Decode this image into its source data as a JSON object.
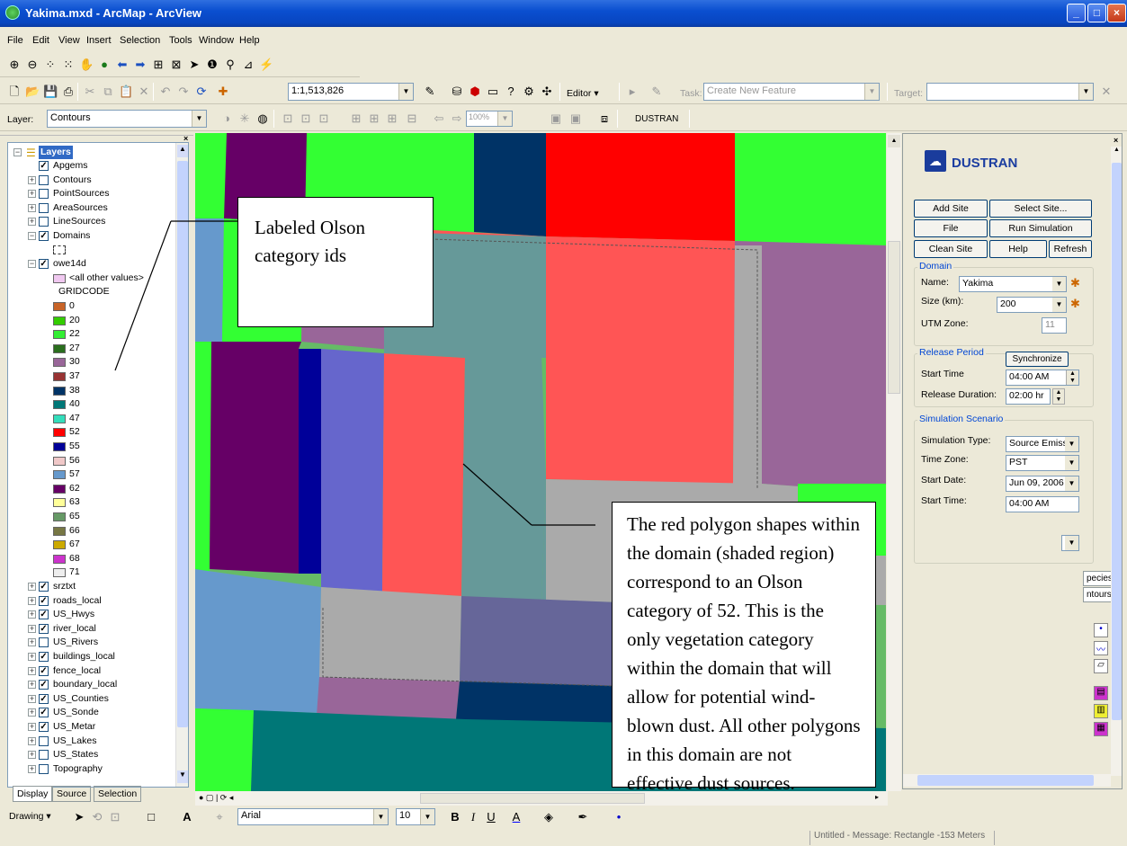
{
  "window": {
    "title": "Yakima.mxd - ArcMap - ArcView",
    "minimize": "_",
    "maximize": "□",
    "close": "×"
  },
  "menu": [
    "File",
    "Edit",
    "View",
    "Insert",
    "Selection",
    "Tools",
    "Window",
    "Help"
  ],
  "toolbar": {
    "scale": "1:1,513,826",
    "editor_label": "Editor ▾",
    "task_label": "Task:",
    "task_value": "Create New Feature",
    "target_label": "Target:",
    "layer_label": "Layer:",
    "layer_value": "Contours",
    "zoom_pct": "100%",
    "dustran_button": "DUSTRAN"
  },
  "toc": {
    "root": "Layers",
    "layers": [
      {
        "name": "Apgems",
        "checked": true,
        "expand": ""
      },
      {
        "name": "Contours",
        "checked": false,
        "expand": "+"
      },
      {
        "name": "PointSources",
        "checked": false,
        "expand": "+"
      },
      {
        "name": "AreaSources",
        "checked": false,
        "expand": "+"
      },
      {
        "name": "LineSources",
        "checked": false,
        "expand": "+"
      },
      {
        "name": "Domains",
        "checked": true,
        "expand": "−"
      }
    ],
    "owe_layer": "owe14d",
    "other_values": "<all other values>",
    "field": "GRIDCODE",
    "legend": [
      {
        "code": "0",
        "color": "#c86428"
      },
      {
        "code": "20",
        "color": "#33cc00"
      },
      {
        "code": "22",
        "color": "#33ee33"
      },
      {
        "code": "27",
        "color": "#2a6e1e"
      },
      {
        "code": "30",
        "color": "#996699"
      },
      {
        "code": "37",
        "color": "#993333"
      },
      {
        "code": "38",
        "color": "#003366"
      },
      {
        "code": "40",
        "color": "#007777"
      },
      {
        "code": "47",
        "color": "#33ddbb"
      },
      {
        "code": "52",
        "color": "#ff0000"
      },
      {
        "code": "55",
        "color": "#000099"
      },
      {
        "code": "56",
        "color": "#f0c8c8"
      },
      {
        "code": "57",
        "color": "#6699cc"
      },
      {
        "code": "62",
        "color": "#660066"
      },
      {
        "code": "63",
        "color": "#ffff99"
      },
      {
        "code": "65",
        "color": "#669966"
      },
      {
        "code": "66",
        "color": "#777744"
      },
      {
        "code": "67",
        "color": "#ccaa00"
      },
      {
        "code": "68",
        "color": "#cc33cc"
      },
      {
        "code": "71",
        "color": "#eeeeee"
      }
    ],
    "layers2": [
      {
        "name": "srztxt",
        "checked": true
      },
      {
        "name": "roads_local",
        "checked": true
      },
      {
        "name": "US_Hwys",
        "checked": true
      },
      {
        "name": "river_local",
        "checked": true
      },
      {
        "name": "US_Rivers",
        "checked": false
      },
      {
        "name": "buildings_local",
        "checked": true
      },
      {
        "name": "fence_local",
        "checked": true
      },
      {
        "name": "boundary_local",
        "checked": true
      },
      {
        "name": "US_Counties",
        "checked": true
      },
      {
        "name": "US_Sonde",
        "checked": true
      },
      {
        "name": "US_Metar",
        "checked": true
      },
      {
        "name": "US_Lakes",
        "checked": false
      },
      {
        "name": "US_States",
        "checked": false
      },
      {
        "name": "Topography",
        "checked": false
      }
    ],
    "tabs": [
      "Display",
      "Source",
      "Selection"
    ]
  },
  "callouts": {
    "top": "Labeled Olson category ids",
    "bottom": "The red polygon shapes within the domain (shaded region) correspond to an Olson category of 52.  This is the only vegetation category within the domain that will allow for potential wind-blown dust.  All other polygons in this domain are not effective dust sources."
  },
  "dustran": {
    "title": "DUSTRAN",
    "buttons": {
      "add_site": "Add Site",
      "select_site": "Select Site...",
      "file": "File",
      "run": "Run Simulation",
      "clean": "Clean Site",
      "help": "Help",
      "refresh": "Refresh"
    },
    "domain": {
      "title": "Domain",
      "name_label": "Name:",
      "name": "Yakima",
      "size_label": "Size (km):",
      "size": "200",
      "utm_label": "UTM Zone:",
      "utm": "11"
    },
    "release": {
      "title": "Release Period",
      "sync": "Synchronize",
      "start_label": "Start Time",
      "start": "04:00 AM",
      "dur_label": "Release Duration:",
      "dur": "02:00 hr"
    },
    "scenario": {
      "title": "Simulation Scenario",
      "type_label": "Simulation Type:",
      "type": "Source Emissio",
      "tz_label": "Time Zone:",
      "tz": "PST",
      "date_label": "Start Date:",
      "date": "Jun 09, 2006",
      "time_label": "Start Time:",
      "time": "04:00 AM"
    },
    "tabs": [
      "pecies",
      "ntours"
    ]
  },
  "drawing": {
    "label": "Drawing ▾",
    "font": "Arial",
    "size": "10"
  },
  "status": "Untitled - Message: Rectangle -153 Meters"
}
